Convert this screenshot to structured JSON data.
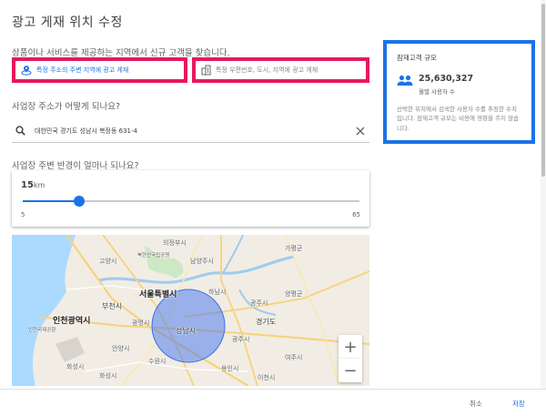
{
  "dialog": {
    "title": "광고 게재 위치 수정"
  },
  "location_question": "상품이나 서비스를 제공하는 지역에서 신규 고객을 찾습니다.",
  "options": [
    {
      "label": "특정 주소의 주변 지역에 광고 게재",
      "selected": true,
      "icon": "location-radius-icon"
    },
    {
      "label": "특정 우편번호, 도시, 지역에 광고 게재",
      "selected": false,
      "icon": "city-icon"
    }
  ],
  "address": {
    "question": "사업장 주소가 어떻게 되나요?",
    "value": "대한민국 경기도 성남시 복정동 631-4"
  },
  "radius": {
    "question": "사업장 주변 반경이 얼마나 되나요?",
    "value": "15",
    "unit": "km",
    "min": "5",
    "max": "65",
    "numeric_value": 15,
    "numeric_min": 5,
    "numeric_max": 65
  },
  "map": {
    "labels": {
      "uijeongbu": "의정부시",
      "namyangju": "남양주시",
      "bukhansan": "북한산국립공원",
      "goyang": "고양시",
      "bucheon": "부천시",
      "seoul": "서울특별시",
      "gwangmyeong": "광명시",
      "incheon": "인천광역시",
      "incheon_airport": "인천국제공항",
      "hanam": "하남시",
      "gwangju": "광주시",
      "seongnam": "성남시",
      "gyeonggi": "경기도",
      "yongin": "용인시",
      "anyang": "안양시",
      "suwon": "수원시",
      "hwaseong": "화성시",
      "yangpyeong": "양평군",
      "gapyeong": "가평군",
      "yeoju": "여주시",
      "icheon": "이천시",
      "gwangju_label": "광주시",
      "hwaseong_south": "화성시"
    },
    "zoom_in": "+",
    "zoom_out": "−"
  },
  "audience": {
    "title": "잠재고객 규모",
    "count": "25,630,327",
    "unit": "월별 사용자 수",
    "description": "선택한 위치에서 검색한 사용자 수를 추정한 수치입니다. 잠재고객 규모는 비용에 영향을 주지 않습니다."
  },
  "footer": {
    "cancel": "취소",
    "save": "저장"
  },
  "colors": {
    "accent": "#1a73e8",
    "highlight_red": "#e8175d",
    "highlight_blue": "#1a73e8"
  }
}
